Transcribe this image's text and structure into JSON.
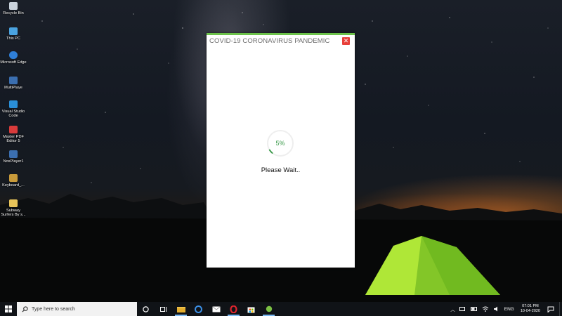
{
  "desktop": {
    "icons": [
      {
        "label": "Recycle Bin",
        "icon": "recycle-bin-icon",
        "color": "#c9d2dc"
      },
      {
        "label": "This PC",
        "icon": "computer-icon",
        "color": "#4aa3e0"
      },
      {
        "label": "Microsoft Edge",
        "icon": "edge-icon",
        "color": "#2f7fd8"
      },
      {
        "label": "MultiPlaye",
        "icon": "multiplayer-icon",
        "color": "#3b6fb0"
      },
      {
        "label": "Visual Studio Code",
        "icon": "vscode-icon",
        "color": "#2a8fd8"
      },
      {
        "label": "Master PDF Editor 5",
        "icon": "pdf-editor-icon",
        "color": "#d93b3b"
      },
      {
        "label": "NoxPlayer1",
        "icon": "noxplayer-icon",
        "color": "#3b6fb0"
      },
      {
        "label": "Keyboard_...",
        "icon": "keyboard-app-icon",
        "color": "#c89a3a"
      },
      {
        "label": "Subway Surfers By s...",
        "icon": "folder-icon",
        "color": "#e8c45a"
      }
    ]
  },
  "window": {
    "title": "COVID-19 CORONAVIRUS PANDEMIC",
    "close_label": "✕",
    "progress": {
      "percent_text": "5%",
      "value": 0.05
    },
    "status_text": "Please Wait..",
    "accent_color": "#6cc24a"
  },
  "taskbar": {
    "search_placeholder": "Type here to search",
    "apps": [
      "cortana-icon",
      "task-view-icon",
      "file-explorer-icon",
      "edge-icon",
      "mail-icon",
      "opera-icon",
      "store-icon",
      "nox-icon"
    ],
    "tray": {
      "language": "ENG",
      "time": "07:01 PM",
      "date": "10-04-2020"
    }
  }
}
